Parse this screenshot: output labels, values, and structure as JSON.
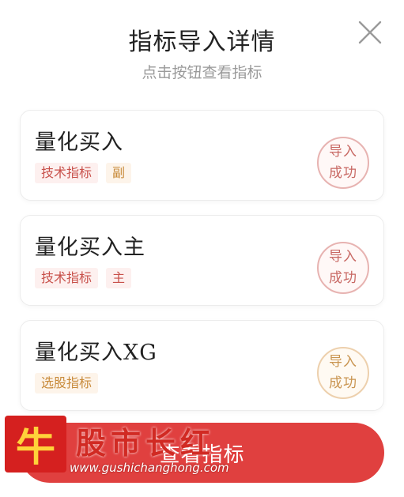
{
  "header": {
    "title": "指标导入详情",
    "subtitle": "点击按钮查看指标"
  },
  "indicators": [
    {
      "name": "量化买入",
      "tags": [
        "技术指标",
        "副"
      ],
      "status_line1": "导入",
      "status_line2": "成功",
      "tone": "red"
    },
    {
      "name": "量化买入主",
      "tags": [
        "技术指标",
        "主"
      ],
      "status_line1": "导入",
      "status_line2": "成功",
      "tone": "red"
    },
    {
      "name": "量化买入XG",
      "tags": [
        "选股指标"
      ],
      "status_line1": "导入",
      "status_line2": "成功",
      "tone": "orange"
    }
  ],
  "cta": {
    "label": "查看指标"
  },
  "watermark": {
    "logo_char": "牛",
    "text": "股市长红",
    "url": "www.gushichanghong.com"
  },
  "colors": {
    "accent": "#e0403f",
    "tag_red": "#c8504a",
    "tag_orange": "#c88a3a"
  },
  "icons": {
    "close": "close-icon"
  }
}
